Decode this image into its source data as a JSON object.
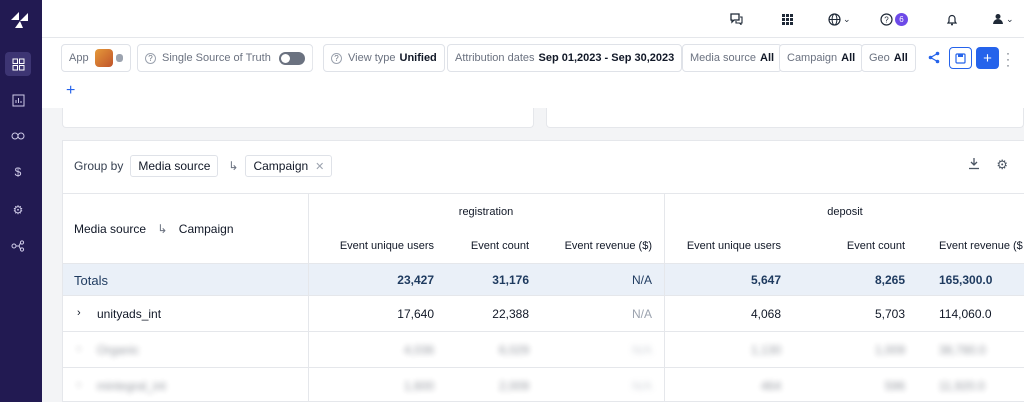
{
  "topbar": {
    "notifications_count": "6"
  },
  "filters": {
    "app_label": "App",
    "ssot_label": "Single Source of Truth",
    "view_type_label": "View type",
    "view_type_value": "Unified",
    "attribution_label": "Attribution dates",
    "attribution_value": "Sep 01,2023 - Sep 30,2023",
    "media_source_label": "Media source",
    "media_source_value": "All",
    "campaign_label": "Campaign",
    "campaign_value": "All",
    "geo_label": "Geo",
    "geo_value": "All",
    "add_filter": "+"
  },
  "table": {
    "group_by_label": "Group by",
    "group_by": [
      "Media source",
      "Campaign"
    ],
    "dimension_header": "Media source",
    "dimension_header_2": "Campaign",
    "event_groups": [
      "registration",
      "deposit"
    ],
    "columns": [
      "Event unique users",
      "Event count",
      "Event revenue ($)",
      "Event unique users",
      "Event count",
      "Event revenue ($"
    ],
    "totals": {
      "label": "Totals",
      "values": [
        "23,427",
        "31,176",
        "N/A",
        "5,647",
        "8,265",
        "165,300.0"
      ]
    },
    "rows": [
      {
        "label": "unityads_int",
        "values": [
          "17,640",
          "22,388",
          "N/A",
          "4,068",
          "5,703",
          "114,060.0"
        ]
      },
      {
        "label": "Organic",
        "values": [
          "4,036",
          "6,029",
          "N/A",
          "1,130",
          "1,009",
          "38,780.0"
        ]
      },
      {
        "label": "mintegral_int",
        "values": [
          "1,600",
          "2,009",
          "N/A",
          "464",
          "596",
          "11,920.0"
        ]
      }
    ]
  },
  "colors": {
    "sidebar": "#221a52",
    "accent": "#2563eb",
    "totals_bg": "#eaf0f8"
  }
}
